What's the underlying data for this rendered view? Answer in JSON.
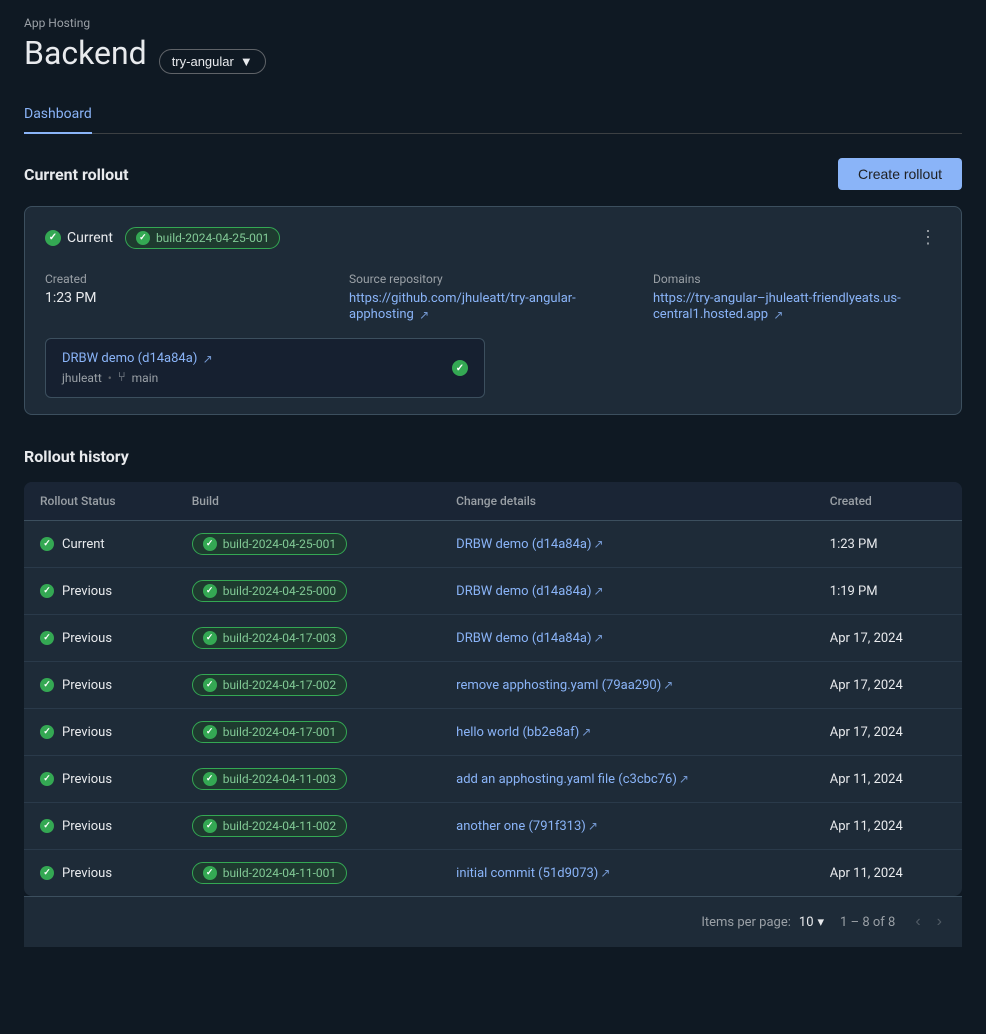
{
  "page": {
    "app_hosting_label": "App Hosting",
    "backend_title": "Backend",
    "branch_selector": {
      "label": "try-angular"
    },
    "nav_tabs": [
      {
        "id": "dashboard",
        "label": "Dashboard",
        "active": true
      }
    ]
  },
  "current_rollout": {
    "section_title": "Current rollout",
    "create_button_label": "Create rollout",
    "status_label": "Current",
    "build_id": "build-2024-04-25-001",
    "more_icon": "⋮",
    "created_label": "Created",
    "created_value": "1:23 PM",
    "source_repo_label": "Source repository",
    "source_repo_url": "https://github.com/jhuleatt/try-angular-apphosting",
    "domains_label": "Domains",
    "domains_url": "https://try-angular–jhuleatt-friendlyeats.us-central1.hosted.app",
    "commit_title": "DRBW demo (d14a84a)",
    "commit_author": "jhuleatt",
    "commit_branch": "main"
  },
  "rollout_history": {
    "section_title": "Rollout history",
    "table": {
      "columns": [
        {
          "id": "status",
          "label": "Rollout Status"
        },
        {
          "id": "build",
          "label": "Build"
        },
        {
          "id": "change",
          "label": "Change details"
        },
        {
          "id": "created",
          "label": "Created"
        }
      ],
      "rows": [
        {
          "status": "Current",
          "build": "build-2024-04-25-001",
          "change": "DRBW demo (d14a84a)",
          "created": "1:23 PM"
        },
        {
          "status": "Previous",
          "build": "build-2024-04-25-000",
          "change": "DRBW demo (d14a84a)",
          "created": "1:19 PM"
        },
        {
          "status": "Previous",
          "build": "build-2024-04-17-003",
          "change": "DRBW demo (d14a84a)",
          "created": "Apr 17, 2024"
        },
        {
          "status": "Previous",
          "build": "build-2024-04-17-002",
          "change": "remove apphosting.yaml (79aa290)",
          "created": "Apr 17, 2024"
        },
        {
          "status": "Previous",
          "build": "build-2024-04-17-001",
          "change": "hello world (bb2e8af)",
          "created": "Apr 17, 2024"
        },
        {
          "status": "Previous",
          "build": "build-2024-04-11-003",
          "change": "add an apphosting.yaml file (c3cbc76)",
          "created": "Apr 11, 2024"
        },
        {
          "status": "Previous",
          "build": "build-2024-04-11-002",
          "change": "another one (791f313)",
          "created": "Apr 11, 2024"
        },
        {
          "status": "Previous",
          "build": "build-2024-04-11-001",
          "change": "initial commit (51d9073)",
          "created": "Apr 11, 2024"
        }
      ]
    },
    "footer": {
      "items_per_page_label": "Items per page:",
      "items_per_page_value": "10",
      "pagination_info": "1 – 8 of 8"
    }
  }
}
